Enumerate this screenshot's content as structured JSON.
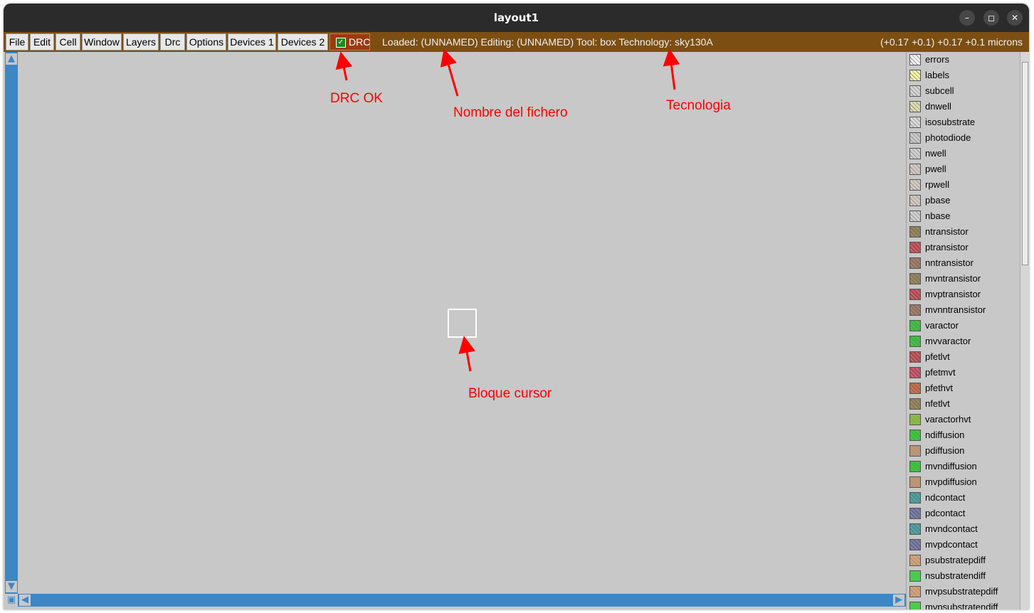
{
  "window": {
    "title": "layout1"
  },
  "window_controls": {
    "minimize": "–",
    "maximize": "◻",
    "close": "✕"
  },
  "menu": [
    {
      "label": "File",
      "icon": ""
    },
    {
      "label": "Edit",
      "icon": ""
    },
    {
      "label": "Cell",
      "icon": ""
    },
    {
      "label": "Window",
      "icon": ""
    },
    {
      "label": "Layers",
      "icon": ""
    },
    {
      "label": "Drc",
      "icon": ""
    },
    {
      "label": "Options",
      "icon": ""
    },
    {
      "label": "Devices 1",
      "icon": ""
    },
    {
      "label": "Devices 2",
      "icon": ""
    }
  ],
  "drc": {
    "label": "DRC",
    "checked": true
  },
  "status": {
    "text": "Loaded: (UNNAMED) Editing: (UNNAMED) Tool: box  Technology: sky130A",
    "coords": "(+0.17 +0.1) +0.17 +0.1 microns"
  },
  "annotations": {
    "drc_ok": "DRC OK",
    "filename": "Nombre del fichero",
    "technology": "Tecnologia",
    "cursor_block": "Bloque cursor"
  },
  "scroll_icons": {
    "up": "▲",
    "down": "▼",
    "left": "◀",
    "right": "▶",
    "corner": "▣"
  },
  "colors": {
    "menubar": "#7c4e12",
    "drc_button": "#9b3a10",
    "drc_ok": "#1c8a1c",
    "annotation": "#ff0000",
    "scrollbar": "#3d87c5"
  },
  "layers": [
    {
      "name": "errors",
      "color": "#f4f4f4"
    },
    {
      "name": "labels",
      "color": "#f5f5a0"
    },
    {
      "name": "subcell",
      "color": "#d4d4d4"
    },
    {
      "name": "dnwell",
      "color": "#dcdcaa"
    },
    {
      "name": "isosubstrate",
      "color": "#d8d8d8"
    },
    {
      "name": "photodiode",
      "color": "#c8c8c8"
    },
    {
      "name": "nwell",
      "color": "#cfcfcf"
    },
    {
      "name": "pwell",
      "color": "#d6c8c0"
    },
    {
      "name": "rpwell",
      "color": "#d6c8c0"
    },
    {
      "name": "pbase",
      "color": "#d6c8c0"
    },
    {
      "name": "nbase",
      "color": "#cfcfcf"
    },
    {
      "name": "ntransistor",
      "color": "#8c7a4a"
    },
    {
      "name": "ptransistor",
      "color": "#c0404a"
    },
    {
      "name": "nntransistor",
      "color": "#9a6e5a"
    },
    {
      "name": "mvntransistor",
      "color": "#8c7a4a"
    },
    {
      "name": "mvptransistor",
      "color": "#c0404a"
    },
    {
      "name": "mvnntransistor",
      "color": "#9a6e5a"
    },
    {
      "name": "varactor",
      "color": "#2ec02e"
    },
    {
      "name": "mvvaractor",
      "color": "#2ec02e"
    },
    {
      "name": "pfetlvt",
      "color": "#c0404a"
    },
    {
      "name": "pfetmvt",
      "color": "#c8405a"
    },
    {
      "name": "pfethvt",
      "color": "#c0603a"
    },
    {
      "name": "nfetlvt",
      "color": "#8c7a4a"
    },
    {
      "name": "varactorhvt",
      "color": "#88c02e"
    },
    {
      "name": "ndiffusion",
      "color": "#22cc22"
    },
    {
      "name": "pdiffusion",
      "color": "#c8946a"
    },
    {
      "name": "mvndiffusion",
      "color": "#22cc22"
    },
    {
      "name": "mvpdiffusion",
      "color": "#c8946a"
    },
    {
      "name": "ndcontact",
      "color": "#3a9a9a"
    },
    {
      "name": "pdcontact",
      "color": "#6a6aa0"
    },
    {
      "name": "mvndcontact",
      "color": "#3a9a9a"
    },
    {
      "name": "mvpdcontact",
      "color": "#6a6aa0"
    },
    {
      "name": "psubstratepdiff",
      "color": "#d8a070"
    },
    {
      "name": "nsubstratendiff",
      "color": "#3ad83a"
    },
    {
      "name": "mvpsubstratepdiff",
      "color": "#d8a070"
    },
    {
      "name": "mvnsubstratendiff",
      "color": "#3ad83a"
    }
  ]
}
